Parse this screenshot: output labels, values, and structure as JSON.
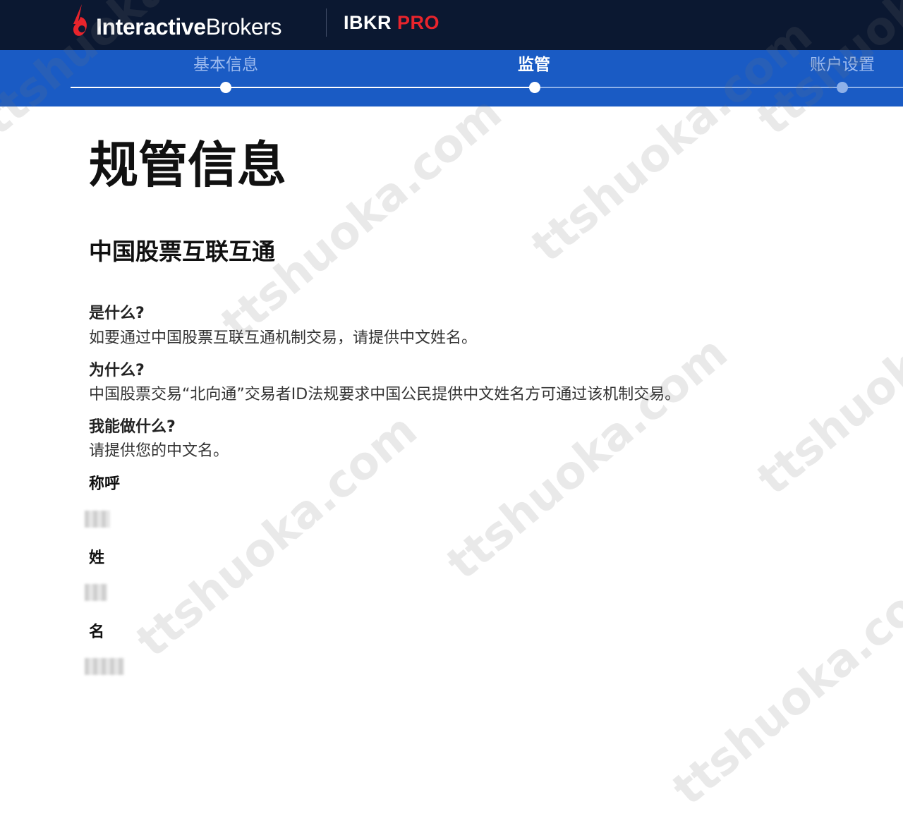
{
  "header": {
    "brand_bold": "Interactive",
    "brand_regular": "Brokers",
    "product_prefix": "IBKR",
    "product_suffix": "PRO",
    "brand_color": "#e8242c",
    "bar_color": "#0b1831"
  },
  "steps": {
    "bar_color": "#1a5bc4",
    "items": [
      {
        "label": "基本信息",
        "state": "completed"
      },
      {
        "label": "监管",
        "state": "current"
      },
      {
        "label": "账户设置",
        "state": "upcoming"
      }
    ]
  },
  "main": {
    "title": "规管信息",
    "section_title": "中国股票互联互通",
    "qa": [
      {
        "question": "是什么?",
        "answer": "如要通过中国股票互联互通机制交易，请提供中文姓名。"
      },
      {
        "question": "为什么?",
        "answer": "中国股票交易“北向通”交易者ID法规要求中国公民提供中文姓名方可通过该机制交易。"
      },
      {
        "question": "我能做什么?",
        "answer": "请提供您的中文名。"
      }
    ],
    "fields": [
      {
        "label": "称呼",
        "value_redacted": true
      },
      {
        "label": "姓",
        "value_redacted": true
      },
      {
        "label": "名",
        "value_redacted": true
      }
    ]
  },
  "watermark": "ttshuoka.com"
}
